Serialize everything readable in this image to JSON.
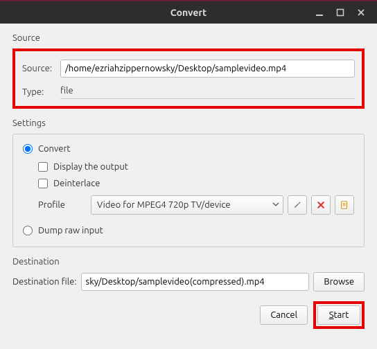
{
  "title": "Convert",
  "source_section": "Source",
  "source_label": "Source:",
  "source_value": "/home/ezriahzippernowsky/Desktop/samplevideo.mp4",
  "type_label": "Type:",
  "type_value": "file",
  "settings_section": "Settings",
  "convert_radio": "Convert",
  "display_check": "Display the output",
  "deinterlace_check": "Deinterlace",
  "profile_label": "Profile",
  "profile_value": "Video for MPEG4 720p TV/device",
  "dump_radio": "Dump raw input",
  "destination_section": "Destination",
  "dest_label": "Destination file:",
  "dest_value": "sky/Desktop/samplevideo(compressed).mp4",
  "browse_btn": "Browse",
  "cancel_btn": "Cancel",
  "start_btn_char": "S",
  "start_btn_rest": "tart"
}
